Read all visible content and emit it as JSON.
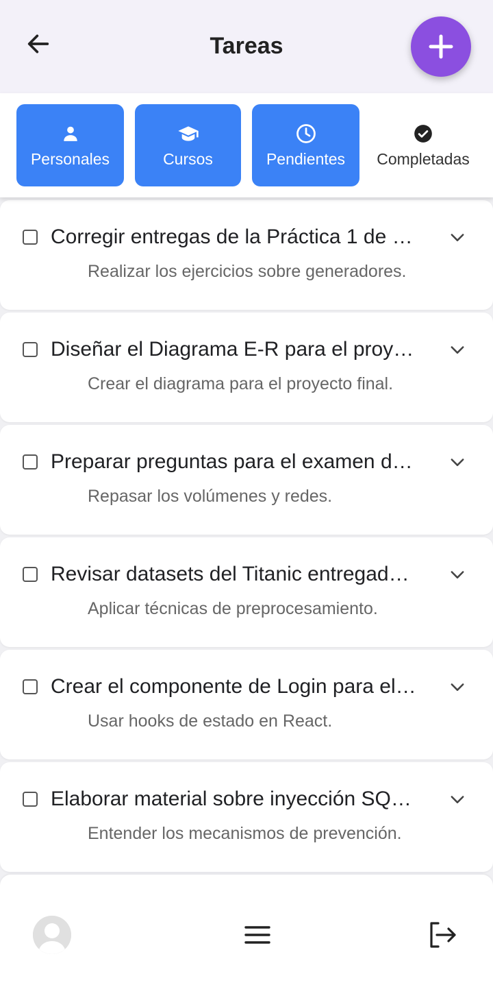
{
  "header": {
    "title": "Tareas",
    "back_icon": "arrow-left-icon",
    "add_icon": "plus-icon",
    "accent_color": "#8b4fe0"
  },
  "tabs": [
    {
      "label": "Personales",
      "icon": "person-icon",
      "active": true
    },
    {
      "label": "Cursos",
      "icon": "graduation-cap-icon",
      "active": true
    },
    {
      "label": "Pendientes",
      "icon": "clock-icon",
      "active": true
    },
    {
      "label": "Completadas",
      "icon": "check-circle-icon",
      "active": false
    }
  ],
  "tab_active_color": "#3b82f6",
  "tasks": [
    {
      "title": "Corregir entregas de la Práctica 1 de …",
      "description": "Realizar los ejercicios sobre generadores.",
      "checked": false
    },
    {
      "title": "Diseñar el Diagrama E-R para el proy…",
      "description": "Crear el diagrama para el proyecto final.",
      "checked": false
    },
    {
      "title": "Preparar preguntas para el examen d…",
      "description": "Repasar los volúmenes y redes.",
      "checked": false
    },
    {
      "title": "Revisar datasets del Titanic entregad…",
      "description": "Aplicar técnicas de preprocesamiento.",
      "checked": false
    },
    {
      "title": "Crear el componente de Login para el…",
      "description": "Usar hooks de estado en React.",
      "checked": false
    },
    {
      "title": "Elaborar material sobre inyección SQ…",
      "description": "Entender los mecanismos de prevención.",
      "checked": false
    }
  ],
  "bottom_nav": {
    "avatar_icon": "user-avatar-icon",
    "menu_icon": "hamburger-menu-icon",
    "logout_icon": "logout-icon"
  }
}
